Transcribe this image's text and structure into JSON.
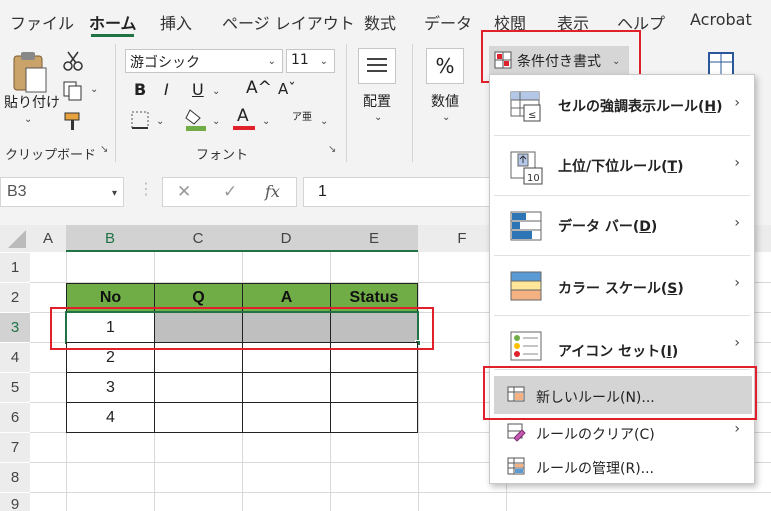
{
  "tabs": [
    "ファイル",
    "ホーム",
    "挿入",
    "ページ レイアウト",
    "数式",
    "データ",
    "校閲",
    "表示",
    "ヘルプ",
    "Acrobat"
  ],
  "ribbon": {
    "paste_label": "貼り付け",
    "clipboard_group": "クリップボード",
    "font_name": "游ゴシック",
    "font_size": "11",
    "bold": "B",
    "italic": "I",
    "underline": "U",
    "grow_font": "A^",
    "shrink_font": "Aˇ",
    "font_color_glyph": "A",
    "phonetic_glyph": "ア亜",
    "font_group": "フォント",
    "align_label": "配置",
    "number_label": "数値",
    "percent_glyph": "%",
    "cf_button": "条件付き書式"
  },
  "formula_bar": {
    "name_box": "B3",
    "cancel": "✕",
    "enter": "✓",
    "fx": "fx",
    "value": "1"
  },
  "sheet": {
    "columns": [
      "A",
      "B",
      "C",
      "D",
      "E",
      "F"
    ],
    "rows": [
      "1",
      "2",
      "3",
      "4",
      "5",
      "6",
      "7",
      "8",
      "9"
    ],
    "table_headers": [
      "No",
      "Q",
      "A",
      "Status"
    ],
    "no_values": [
      "1",
      "2",
      "3",
      "4"
    ]
  },
  "menu": {
    "items": [
      {
        "label": "セルの強調表示ルール",
        "key": "H"
      },
      {
        "label": "上位/下位ルール",
        "key": "T"
      },
      {
        "label": "データ バー",
        "key": "D"
      },
      {
        "label": "カラー スケール",
        "key": "S"
      },
      {
        "label": "アイコン セット",
        "key": "I"
      }
    ],
    "new_rule": "新しいルール(N)...",
    "clear_rules": "ルールのクリア(C)",
    "manage_rules": "ルールの管理(R)..."
  },
  "colors": {
    "excel_green": "#217346",
    "header_fill": "#70ad47",
    "highlight_red": "#e0202a"
  }
}
